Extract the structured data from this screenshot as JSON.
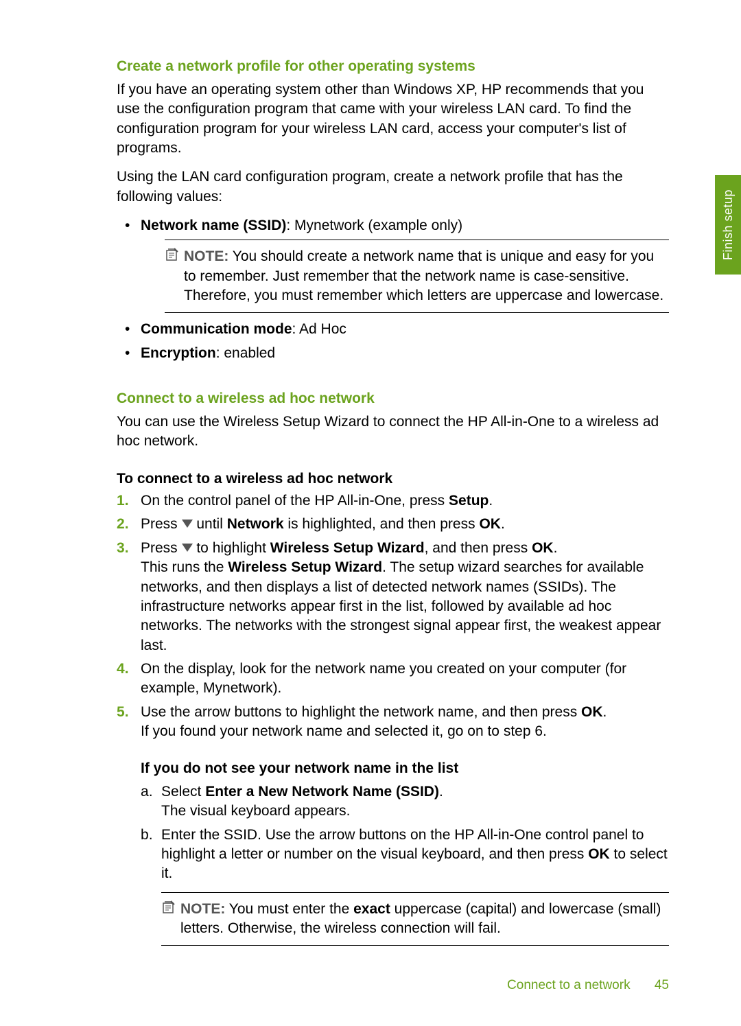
{
  "sideTab": "Finish setup",
  "section1": {
    "heading": "Create a network profile for other operating systems",
    "para1": "If you have an operating system other than Windows XP, HP recommends that you use the configuration program that came with your wireless LAN card. To find the configuration program for your wireless LAN card, access your computer's list of programs.",
    "para2": "Using the LAN card configuration program, create a network profile that has the following values:",
    "bullet1_label": "Network name (SSID)",
    "bullet1_value": ": Mynetwork (example only)",
    "note1_label": "NOTE:",
    "note1_text": "  You should create a network name that is unique and easy for you to remember. Just remember that the network name is case-sensitive. Therefore, you must remember which letters are uppercase and lowercase.",
    "bullet2_label": "Communication mode",
    "bullet2_value": ": Ad Hoc",
    "bullet3_label": "Encryption",
    "bullet3_value": ": enabled"
  },
  "section2": {
    "heading": "Connect to a wireless ad hoc network",
    "para1": "You can use the Wireless Setup Wizard to connect the HP All-in-One to a wireless ad hoc network.",
    "subheading": "To connect to a wireless ad hoc network",
    "step1_pre": "On the control panel of the HP All-in-One, press ",
    "step1_bold": "Setup",
    "step1_post": ".",
    "step2_pre": "Press ",
    "step2_mid": " until ",
    "step2_bold1": "Network",
    "step2_mid2": " is highlighted, and then press ",
    "step2_bold2": "OK",
    "step2_post": ".",
    "step3_pre": "Press ",
    "step3_mid": " to highlight ",
    "step3_bold1": "Wireless Setup Wizard",
    "step3_mid2": ", and then press ",
    "step3_bold2": "OK",
    "step3_post": ".",
    "step3_line2_pre": "This runs the ",
    "step3_line2_bold": "Wireless Setup Wizard",
    "step3_line2_post": ". The setup wizard searches for available networks, and then displays a list of detected network names (SSIDs). The infrastructure networks appear first in the list, followed by available ad hoc networks. The networks with the strongest signal appear first, the weakest appear last.",
    "step4": "On the display, look for the network name you created on your computer (for example, Mynetwork).",
    "step5_pre": "Use the arrow buttons to highlight the network name, and then press ",
    "step5_bold": "OK",
    "step5_post": ".",
    "step5_line2": "If you found your network name and selected it, go on to step 6.",
    "nestedHeading": "If you do not see your network name in the list",
    "stepa_pre": "Select ",
    "stepa_bold": "Enter a New Network Name (SSID)",
    "stepa_post": ".",
    "stepa_line2": "The visual keyboard appears.",
    "stepb_pre": "Enter the SSID. Use the arrow buttons on the HP All-in-One control panel to highlight a letter or number on the visual keyboard, and then press ",
    "stepb_bold": "OK",
    "stepb_post": " to select it.",
    "note2_label": "NOTE:",
    "note2_text_pre": "  You must enter the ",
    "note2_text_bold": "exact",
    "note2_text_post": " uppercase (capital) and lowercase (small) letters. Otherwise, the wireless connection will fail."
  },
  "footer": {
    "section": "Connect to a network",
    "page": "45"
  }
}
